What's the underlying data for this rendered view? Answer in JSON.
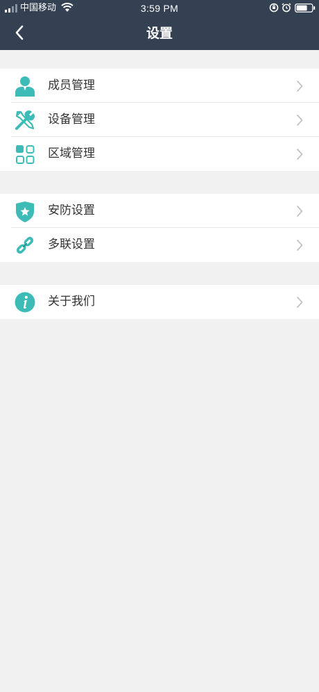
{
  "status_bar": {
    "carrier": "中国移动",
    "time": "3:59 PM"
  },
  "header": {
    "title": "设置"
  },
  "groups": [
    {
      "items": [
        {
          "label": "成员管理",
          "icon": "member-icon"
        },
        {
          "label": "设备管理",
          "icon": "tools-icon"
        },
        {
          "label": "区域管理",
          "icon": "grid-icon"
        }
      ]
    },
    {
      "items": [
        {
          "label": "安防设置",
          "icon": "shield-star-icon"
        },
        {
          "label": "多联设置",
          "icon": "link-icon"
        }
      ]
    },
    {
      "items": [
        {
          "label": "关于我们",
          "icon": "info-icon"
        }
      ]
    }
  ],
  "colors": {
    "header_bg": "#344152",
    "accent": "#3dbcb7",
    "page_bg": "#f1f1f1"
  }
}
